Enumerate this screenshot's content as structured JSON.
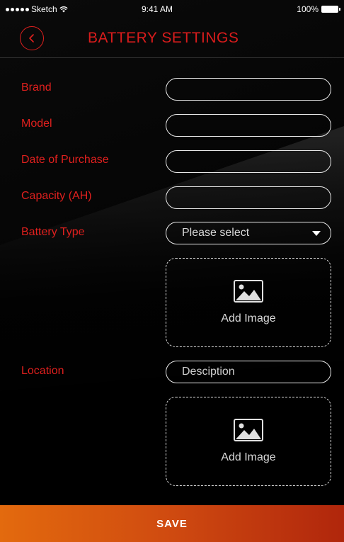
{
  "status_bar": {
    "carrier": "Sketch",
    "time": "9:41 AM",
    "battery": "100%",
    "icons": [
      "signal-dots-icon",
      "wifi-icon",
      "battery-icon"
    ]
  },
  "nav": {
    "title": "BATTERY SETTINGS",
    "back_icon": "chevron-left-icon"
  },
  "form": {
    "brand": {
      "label": "Brand",
      "value": ""
    },
    "model": {
      "label": "Model",
      "value": ""
    },
    "date_of_purchase": {
      "label": "Date of Purchase",
      "value": ""
    },
    "capacity": {
      "label": "Capacity (AH)",
      "value": ""
    },
    "battery_type": {
      "label": "Battery Type",
      "selected": "Please select"
    },
    "battery_image": {
      "label": "Add Image",
      "icon": "image-icon"
    },
    "location": {
      "label": "Location",
      "placeholder": "Desciption",
      "value": ""
    },
    "location_image": {
      "label": "Add Image",
      "icon": "image-icon"
    }
  },
  "save_label": "SAVE",
  "colors": {
    "accent_red": "#e0201e",
    "title_red": "#d81c1c",
    "save_gradient_start": "#e36a0e",
    "save_gradient_end": "#b0260c",
    "background": "#000000"
  }
}
